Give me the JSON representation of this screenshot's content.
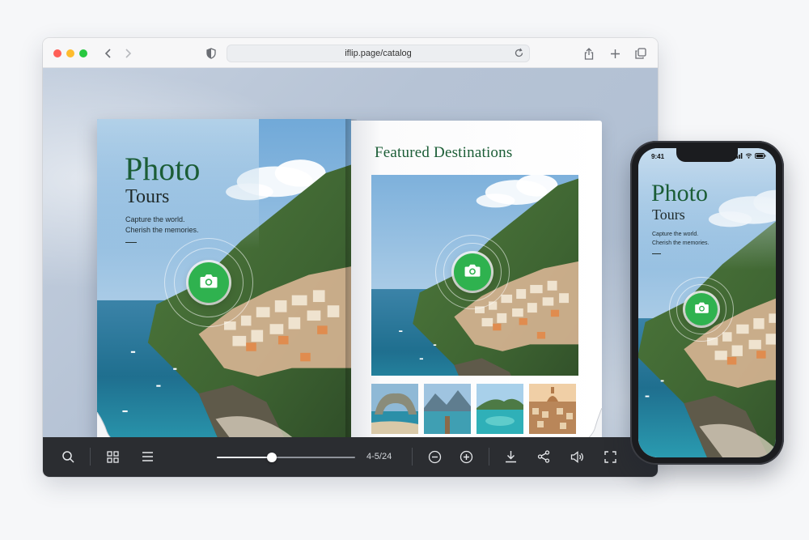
{
  "browser": {
    "url": "iflip.page/catalog",
    "icons": {
      "back": "chevron-left-icon",
      "forward": "chevron-right-icon",
      "privacy": "shield-icon",
      "reload": "reload-icon",
      "share": "share-icon",
      "new_tab": "plus-icon",
      "tabs": "tabs-overview-icon"
    }
  },
  "book": {
    "left_page": {
      "title_line1": "Photo",
      "title_line2": "Tours",
      "tagline_line1": "Capture the world.",
      "tagline_line2": "Cherish the memories."
    },
    "right_page": {
      "heading": "Featured Destinations",
      "thumbnails": [
        "sea-arch",
        "lake-pier",
        "lagoon",
        "domed-city"
      ]
    },
    "badge_icon": "camera-icon"
  },
  "toolbar": {
    "page_indicator": "4-5/24",
    "progress": 0.4,
    "icons": [
      "search-icon",
      "grid-icon",
      "menu-icon",
      "zoom-out-icon",
      "zoom-in-icon",
      "download-icon",
      "share-nodes-icon",
      "volume-icon",
      "fullscreen-icon"
    ]
  },
  "phone": {
    "time": "9:41",
    "title_line1": "Photo",
    "title_line2": "Tours",
    "tagline_line1": "Capture the world.",
    "tagline_line2": "Cherish the memories."
  },
  "colors": {
    "brand_green": "#1b5d36",
    "camera_green": "#2fb24f",
    "toolbar_bg": "#2b2d31"
  }
}
